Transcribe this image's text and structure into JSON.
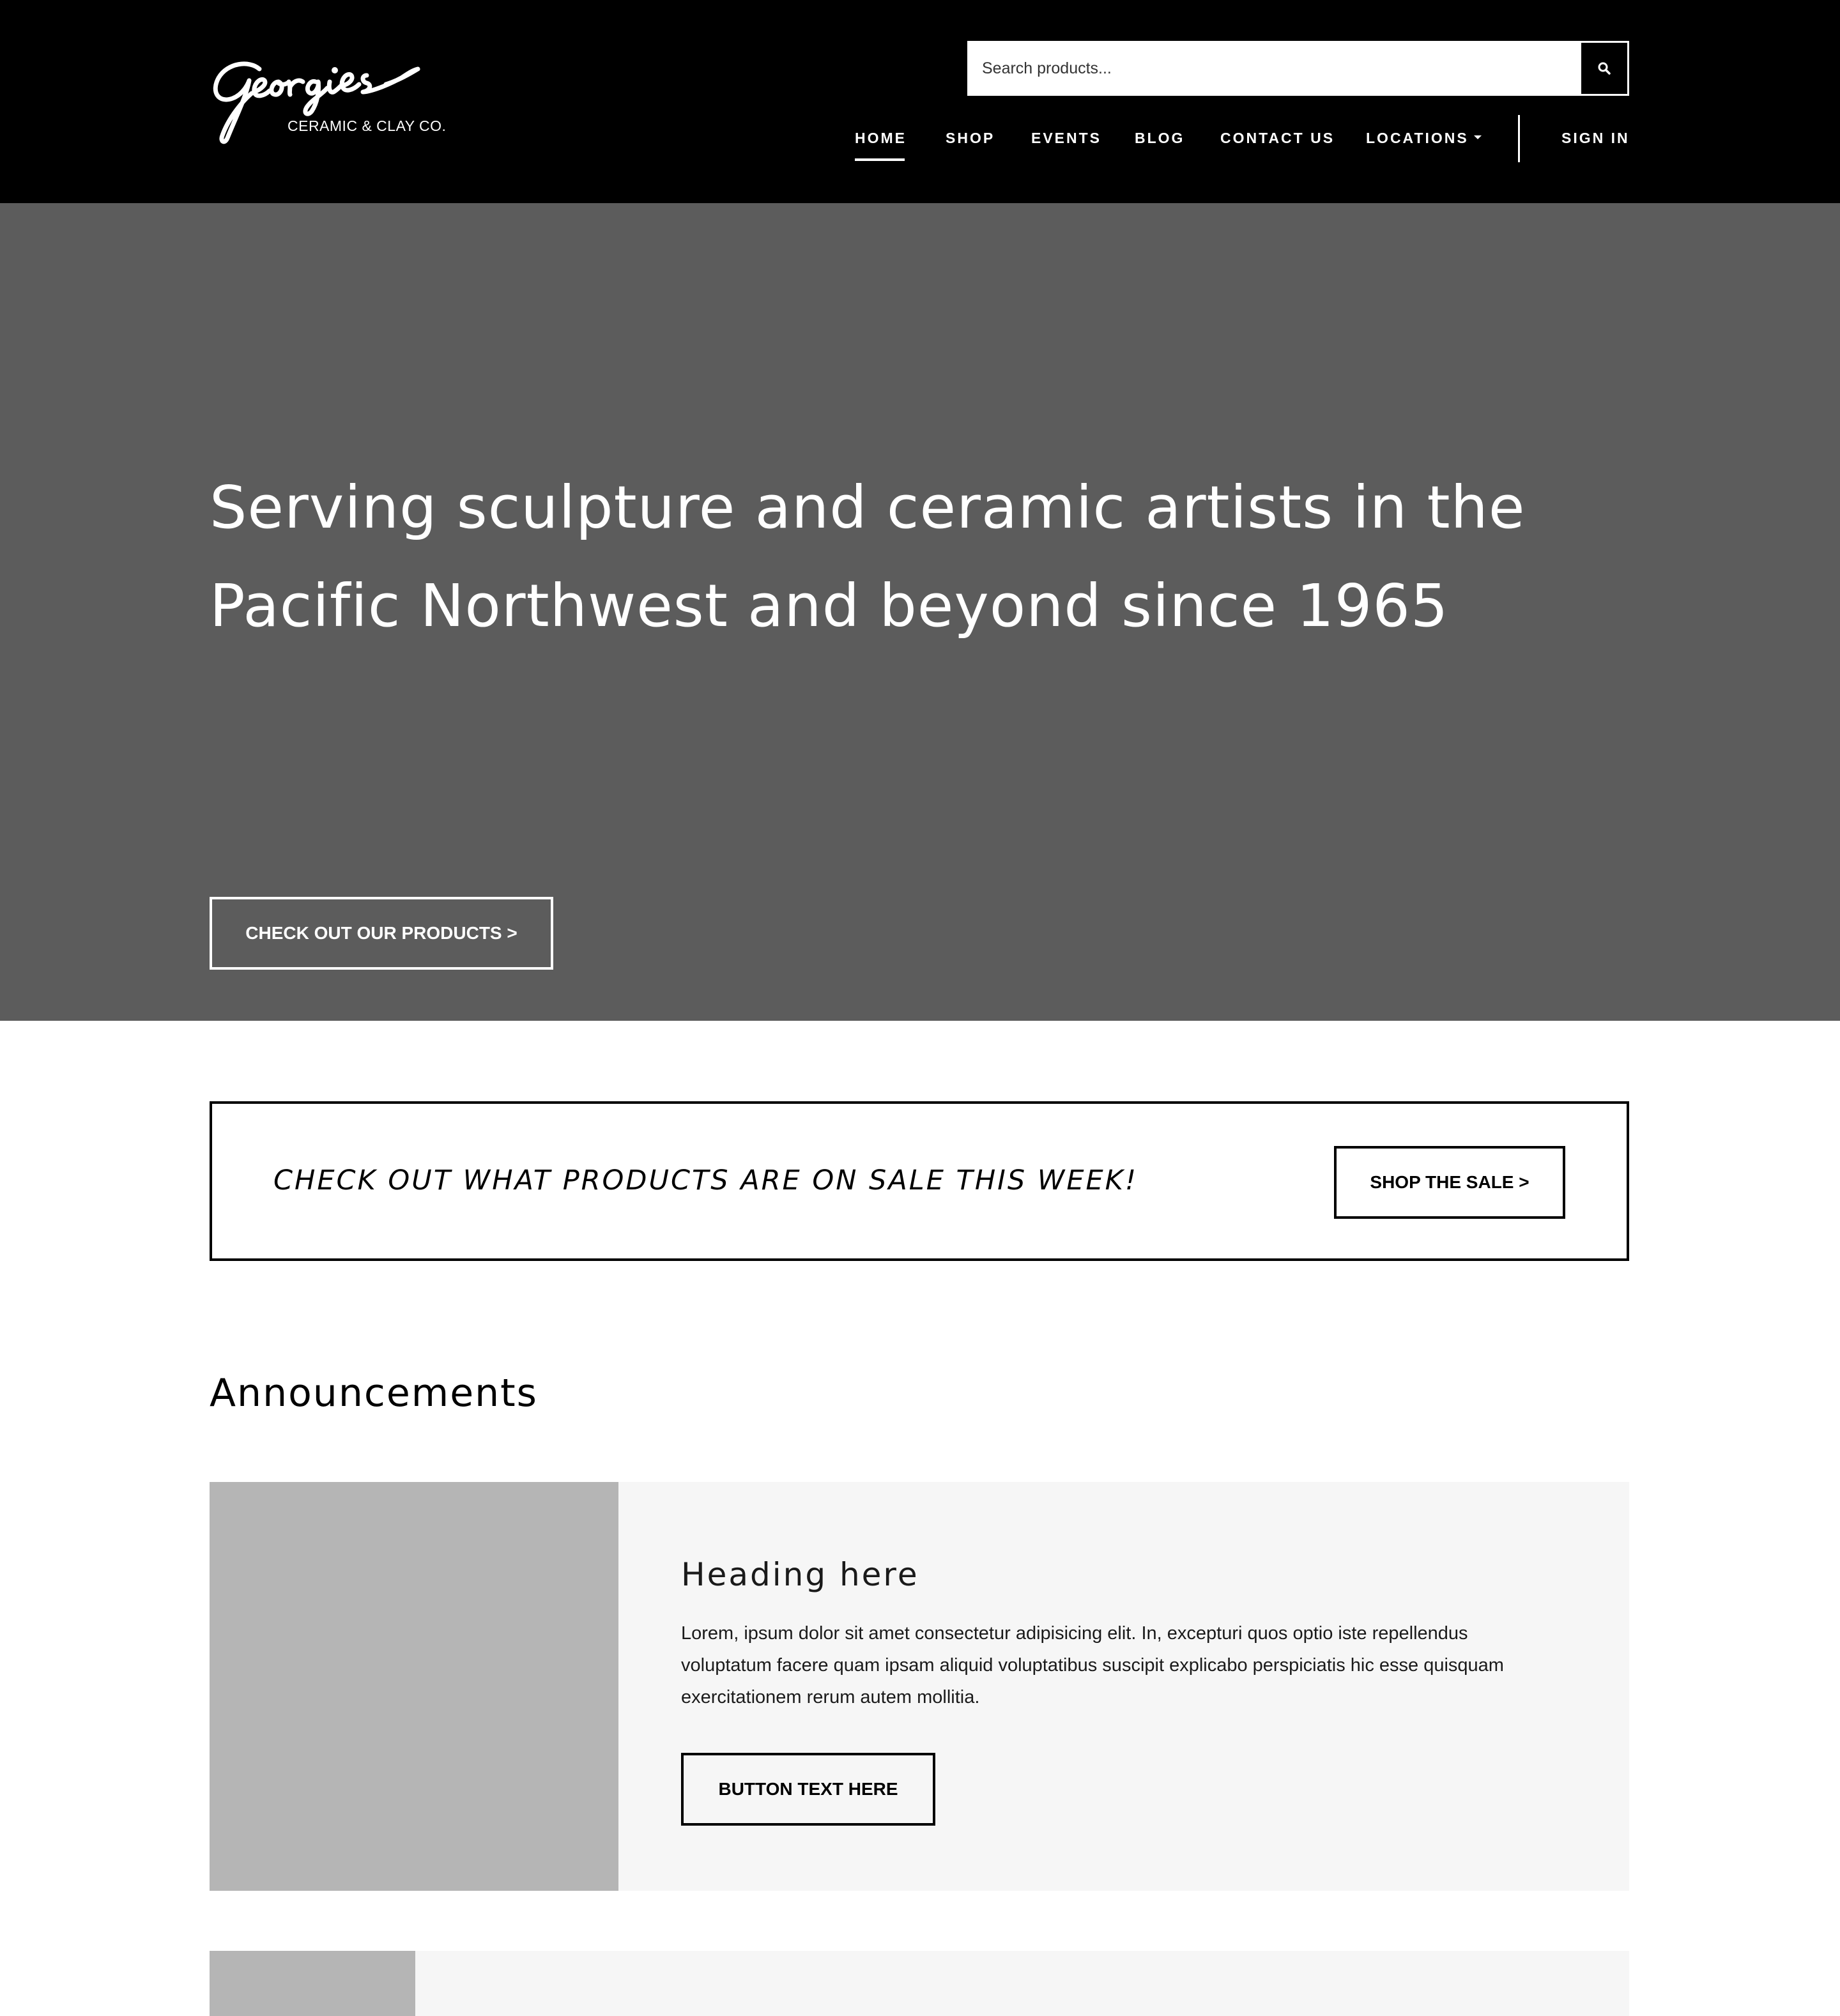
{
  "header": {
    "logo": {
      "wordmark": "Georgies",
      "tagline": "CERAMIC & CLAY CO."
    },
    "search": {
      "placeholder": "Search products...",
      "value": "",
      "button_icon": "search-icon"
    },
    "nav": {
      "items": [
        {
          "label": "HOME",
          "active": true
        },
        {
          "label": "SHOP",
          "active": false
        },
        {
          "label": "EVENTS",
          "active": false
        },
        {
          "label": "BLOG",
          "active": false
        },
        {
          "label": "CONTACT US",
          "active": false
        },
        {
          "label": "LOCATIONS",
          "active": false,
          "has_dropdown": true
        }
      ],
      "sign_in_label": "SIGN IN"
    }
  },
  "hero": {
    "title": "Serving sculpture and ceramic artists in the Pacific Northwest and beyond since 1965",
    "cta_label": "CHECK OUT OUR PRODUCTS >"
  },
  "sale_banner": {
    "text": "CHECK OUT WHAT PRODUCTS ARE ON SALE THIS WEEK!",
    "button_label": "SHOP THE SALE >"
  },
  "announcements": {
    "title": "Announcements",
    "cards": [
      {
        "heading": "Heading here",
        "body": "Lorem, ipsum dolor sit amet consectetur adipisicing elit. In, excepturi quos optio iste repellendus voluptatum facere quam ipsam aliquid voluptatibus suscipit explicabo perspiciatis hic esse quisquam exercitationem rerum autem mollitia.",
        "button_label": "BUTTON TEXT HERE"
      }
    ]
  },
  "colors": {
    "header_bg": "#000000",
    "hero_bg": "#5c5c5c",
    "card_bg": "#f6f6f6",
    "image_placeholder": "#b5b5b5",
    "text_light": "#ffffff",
    "text_dark": "#000000"
  }
}
